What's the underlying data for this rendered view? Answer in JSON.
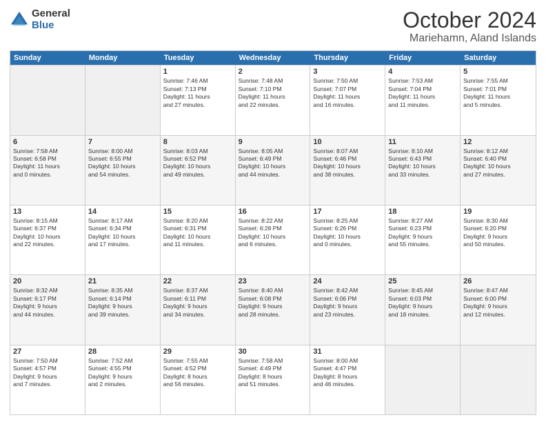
{
  "logo": {
    "general": "General",
    "blue": "Blue"
  },
  "title": {
    "month": "October 2024",
    "location": "Mariehamn, Aland Islands"
  },
  "weekdays": [
    "Sunday",
    "Monday",
    "Tuesday",
    "Wednesday",
    "Thursday",
    "Friday",
    "Saturday"
  ],
  "rows": [
    [
      {
        "day": "",
        "info": ""
      },
      {
        "day": "",
        "info": ""
      },
      {
        "day": "1",
        "info": "Sunrise: 7:46 AM\nSunset: 7:13 PM\nDaylight: 11 hours\nand 27 minutes."
      },
      {
        "day": "2",
        "info": "Sunrise: 7:48 AM\nSunset: 7:10 PM\nDaylight: 11 hours\nand 22 minutes."
      },
      {
        "day": "3",
        "info": "Sunrise: 7:50 AM\nSunset: 7:07 PM\nDaylight: 11 hours\nand 16 minutes."
      },
      {
        "day": "4",
        "info": "Sunrise: 7:53 AM\nSunset: 7:04 PM\nDaylight: 11 hours\nand 11 minutes."
      },
      {
        "day": "5",
        "info": "Sunrise: 7:55 AM\nSunset: 7:01 PM\nDaylight: 11 hours\nand 5 minutes."
      }
    ],
    [
      {
        "day": "6",
        "info": "Sunrise: 7:58 AM\nSunset: 6:58 PM\nDaylight: 11 hours\nand 0 minutes."
      },
      {
        "day": "7",
        "info": "Sunrise: 8:00 AM\nSunset: 6:55 PM\nDaylight: 10 hours\nand 54 minutes."
      },
      {
        "day": "8",
        "info": "Sunrise: 8:03 AM\nSunset: 6:52 PM\nDaylight: 10 hours\nand 49 minutes."
      },
      {
        "day": "9",
        "info": "Sunrise: 8:05 AM\nSunset: 6:49 PM\nDaylight: 10 hours\nand 44 minutes."
      },
      {
        "day": "10",
        "info": "Sunrise: 8:07 AM\nSunset: 6:46 PM\nDaylight: 10 hours\nand 38 minutes."
      },
      {
        "day": "11",
        "info": "Sunrise: 8:10 AM\nSunset: 6:43 PM\nDaylight: 10 hours\nand 33 minutes."
      },
      {
        "day": "12",
        "info": "Sunrise: 8:12 AM\nSunset: 6:40 PM\nDaylight: 10 hours\nand 27 minutes."
      }
    ],
    [
      {
        "day": "13",
        "info": "Sunrise: 8:15 AM\nSunset: 6:37 PM\nDaylight: 10 hours\nand 22 minutes."
      },
      {
        "day": "14",
        "info": "Sunrise: 8:17 AM\nSunset: 6:34 PM\nDaylight: 10 hours\nand 17 minutes."
      },
      {
        "day": "15",
        "info": "Sunrise: 8:20 AM\nSunset: 6:31 PM\nDaylight: 10 hours\nand 11 minutes."
      },
      {
        "day": "16",
        "info": "Sunrise: 8:22 AM\nSunset: 6:28 PM\nDaylight: 10 hours\nand 6 minutes."
      },
      {
        "day": "17",
        "info": "Sunrise: 8:25 AM\nSunset: 6:26 PM\nDaylight: 10 hours\nand 0 minutes."
      },
      {
        "day": "18",
        "info": "Sunrise: 8:27 AM\nSunset: 6:23 PM\nDaylight: 9 hours\nand 55 minutes."
      },
      {
        "day": "19",
        "info": "Sunrise: 8:30 AM\nSunset: 6:20 PM\nDaylight: 9 hours\nand 50 minutes."
      }
    ],
    [
      {
        "day": "20",
        "info": "Sunrise: 8:32 AM\nSunset: 6:17 PM\nDaylight: 9 hours\nand 44 minutes."
      },
      {
        "day": "21",
        "info": "Sunrise: 8:35 AM\nSunset: 6:14 PM\nDaylight: 9 hours\nand 39 minutes."
      },
      {
        "day": "22",
        "info": "Sunrise: 8:37 AM\nSunset: 6:11 PM\nDaylight: 9 hours\nand 34 minutes."
      },
      {
        "day": "23",
        "info": "Sunrise: 8:40 AM\nSunset: 6:08 PM\nDaylight: 9 hours\nand 28 minutes."
      },
      {
        "day": "24",
        "info": "Sunrise: 8:42 AM\nSunset: 6:06 PM\nDaylight: 9 hours\nand 23 minutes."
      },
      {
        "day": "25",
        "info": "Sunrise: 8:45 AM\nSunset: 6:03 PM\nDaylight: 9 hours\nand 18 minutes."
      },
      {
        "day": "26",
        "info": "Sunrise: 8:47 AM\nSunset: 6:00 PM\nDaylight: 9 hours\nand 12 minutes."
      }
    ],
    [
      {
        "day": "27",
        "info": "Sunrise: 7:50 AM\nSunset: 4:57 PM\nDaylight: 9 hours\nand 7 minutes."
      },
      {
        "day": "28",
        "info": "Sunrise: 7:52 AM\nSunset: 4:55 PM\nDaylight: 9 hours\nand 2 minutes."
      },
      {
        "day": "29",
        "info": "Sunrise: 7:55 AM\nSunset: 4:52 PM\nDaylight: 8 hours\nand 56 minutes."
      },
      {
        "day": "30",
        "info": "Sunrise: 7:58 AM\nSunset: 4:49 PM\nDaylight: 8 hours\nand 51 minutes."
      },
      {
        "day": "31",
        "info": "Sunrise: 8:00 AM\nSunset: 4:47 PM\nDaylight: 8 hours\nand 46 minutes."
      },
      {
        "day": "",
        "info": ""
      },
      {
        "day": "",
        "info": ""
      }
    ]
  ]
}
